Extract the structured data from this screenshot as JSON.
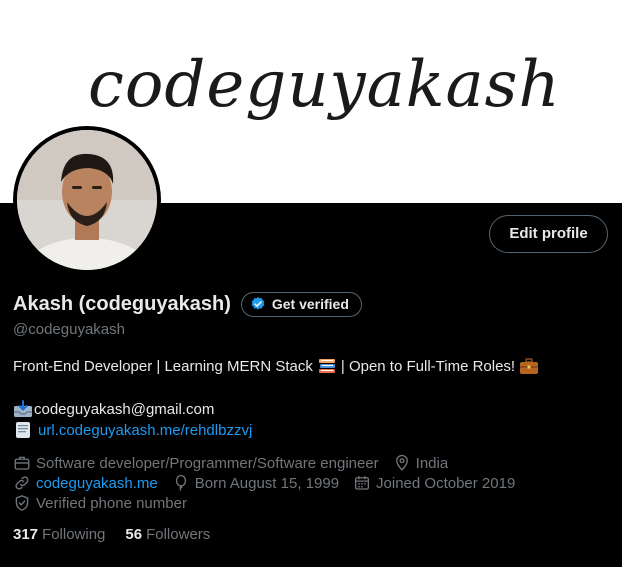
{
  "banner": {
    "text": "codeguyakash"
  },
  "header": {
    "edit_profile_label": "Edit profile"
  },
  "profile": {
    "display_name": "Akash (codeguyakash)",
    "get_verified_label": "Get verified",
    "handle": "@codeguyakash",
    "bio_part1": "Front-End Developer | Learning MERN Stack",
    "bio_part2": "| Open to Full-Time Roles!",
    "email": "codeguyakash@gmail.com",
    "url": "url.codeguyakash.me/rehdlbzzvj"
  },
  "meta": {
    "profession": "Software developer/Programmer/Software engineer",
    "location": "India",
    "website": "codeguyakash.me",
    "born": "Born August 15, 1999",
    "joined": "Joined October 2019",
    "phone": "Verified phone number"
  },
  "stats": {
    "following_count": "317",
    "following_label": "Following",
    "followers_count": "56",
    "followers_label": "Followers"
  },
  "colors": {
    "accent": "#1d9bf0",
    "muted": "#71767b",
    "text": "#e7e9ea",
    "background": "#000000"
  }
}
